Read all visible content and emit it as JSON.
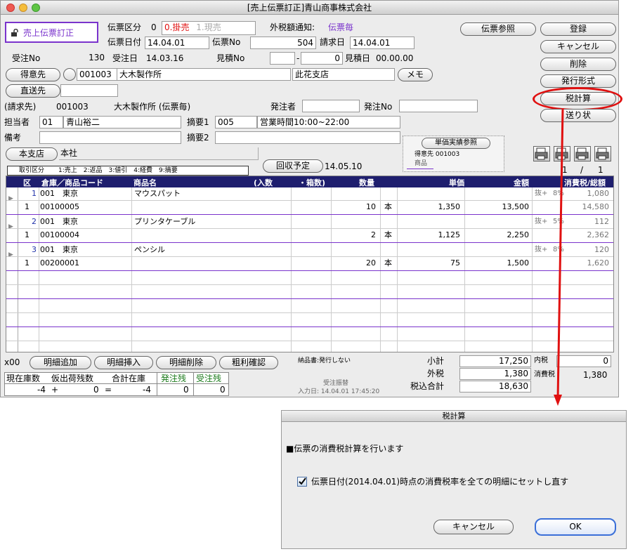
{
  "window": {
    "title": "[売上伝票訂正]青山商事株式会社"
  },
  "header": {
    "mode_badge": "売上伝票訂正",
    "denpyo_kubun_label": "伝票区分",
    "denpyo_kubun_value": "0",
    "kubun_option_1": "0.掛売",
    "kubun_option_2": "1.現売",
    "gaizei_label": "外税額通知:",
    "gaizei_value": "伝票毎",
    "denpyo_date_label": "伝票日付",
    "denpyo_date_value": "14.04.01",
    "denpyo_no_label": "伝票No",
    "denpyo_no_value": "504",
    "seikyu_date_label": "請求日",
    "seikyu_date_value": "14.04.01",
    "juchu_no_label": "受注No",
    "juchu_no_value": "130",
    "juchu_date_label": "受注日",
    "juchu_date_value": "14.03.16",
    "mitsumori_no_label": "見積No",
    "mitsumori_no_prefix": "",
    "mitsumori_no_dash": "-",
    "mitsumori_no_value": "0",
    "mitsumori_date_label": "見積日",
    "mitsumori_date_value": "00.00.00",
    "tokuisaki_button": "得意先",
    "tokuisaki_code": "001003",
    "tokuisaki_name": "大木製作所",
    "tokuisaki_branch": "此花支店",
    "memo_button": "メモ",
    "chokusosaki_button": "直送先",
    "seikyusaki_label": "(請求先)",
    "seikyusaki_code": "001003",
    "seikyusaki_name": "大木製作所 (伝票毎)",
    "hacchusha_label": "発注者",
    "hacchu_no_label": "発注No",
    "tantosha_label": "担当者",
    "tantosha_code": "01",
    "tantosha_name": "青山裕二",
    "tekiyo1_label": "摘要1",
    "tekiyo1_code": "005",
    "tekiyo1_text": "営業時間10:00~22:00",
    "biko_label": "備考",
    "tekiyo2_label": "摘要2",
    "honshiten_button": "本支店",
    "honshiten_value": "本社",
    "torihiki_kubun_label": "取引区分",
    "torihiki_kubun_options": "1:売上　2:返品　3:値引　4:経費　9:摘要",
    "kaishu_button": "回収予定",
    "kaishu_date": "14.05.10",
    "tanka_button": "単価実績参照",
    "tanka_tokuisaki": "得意先 001003",
    "tanka_shohin": "商品",
    "page_current": "1",
    "page_sep": "/",
    "page_total": "1"
  },
  "right_buttons": {
    "denpyo_sansho": "伝票参照",
    "toroku": "登録",
    "cancel": "キャンセル",
    "sakujo": "削除",
    "hakko": "発行形式",
    "zeikeisan": "税計算",
    "okurijo": "送り状"
  },
  "table": {
    "columns": {
      "ku": "区",
      "soko": "倉庫／商品コード",
      "shohin": "商品名",
      "irisu": "(入数",
      "hakosu": "・箱数)",
      "suryo": "数量",
      "tanka": "単価",
      "kingaku": "金額",
      "zei": "消費税/総額"
    },
    "rows": [
      {
        "no": "1",
        "soko_code": "001",
        "soko_name": "東京",
        "shohin_name": "マウスパット",
        "tax_type": "抜+",
        "tax_rate": "8%",
        "tax_amount": "1,080",
        "kubun": "1",
        "shohin_code": "00100005",
        "suryo": "10",
        "tani": "本",
        "tanka": "1,350",
        "kingaku": "13,500",
        "total": "14,580"
      },
      {
        "no": "2",
        "soko_code": "001",
        "soko_name": "東京",
        "shohin_name": "プリンタケーブル",
        "tax_type": "抜+",
        "tax_rate": "5%",
        "tax_amount": "112",
        "kubun": "1",
        "shohin_code": "00100004",
        "suryo": "2",
        "tani": "本",
        "tanka": "1,125",
        "kingaku": "2,250",
        "total": "2,362"
      },
      {
        "no": "3",
        "soko_code": "001",
        "soko_name": "東京",
        "shohin_name": "ペンシル",
        "tax_type": "抜+",
        "tax_rate": "8%",
        "tax_amount": "120",
        "kubun": "1",
        "shohin_code": "00200001",
        "suryo": "20",
        "tani": "本",
        "tanka": "75",
        "kingaku": "1,500",
        "total": "1,620"
      }
    ]
  },
  "footer": {
    "x00": "x00",
    "meisai_tsuika": "明細追加",
    "meisai_sonyu": "明細挿入",
    "meisai_sakujo": "明細削除",
    "arari_kakunin": "粗利確認",
    "nohinsho": "納品書:発行しない",
    "juchu_tenkai": "受注振替",
    "nyuryoku_date": "入力日: 14.04.01 17:45:20",
    "shokei_label": "小計",
    "shokei_value": "17,250",
    "gaizei_label": "外税",
    "gaizei_value": "1,380",
    "zeikomi_label": "税込合計",
    "zeikomi_value": "18,630",
    "naizei_label": "内税",
    "naizei_value": "0",
    "shohizei_label": "消費税",
    "shohizei_value": "1,380",
    "zaiko_h1": "現在庫数",
    "zaiko_h2": "仮出荷残数",
    "zaiko_h3": "合計在庫",
    "zaiko_h4": "発注残",
    "zaiko_h5": "受注残",
    "zaiko_v1": "-4",
    "zaiko_plus": "+",
    "zaiko_v2": "0",
    "zaiko_eq": "=",
    "zaiko_v3": "-4",
    "zaiko_v4": "0",
    "zaiko_v5": "0"
  },
  "dialog": {
    "title": "税計算",
    "heading": "■伝票の消費税計算を行います",
    "checkbox_label": "伝票日付(2014.04.01)時点の消費税率を全ての明細にセットし直す",
    "cancel": "キャンセル",
    "ok": "OK"
  },
  "colors": {
    "purple": "#7a33cc",
    "red_highlight": "#e01010",
    "header_navy": "#1e1e6e",
    "blue_text": "#2233aa",
    "green_text": "#1a7a1a"
  }
}
